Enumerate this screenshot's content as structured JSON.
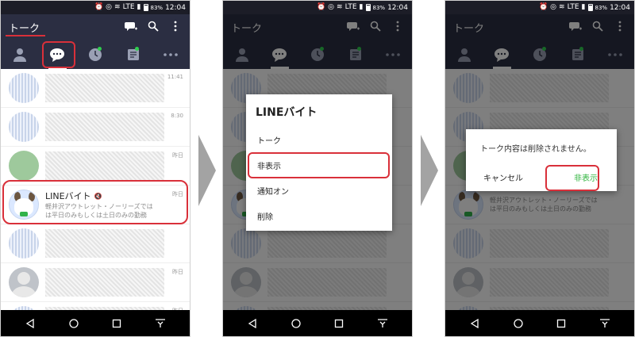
{
  "status": {
    "battery": "83%",
    "time": "12:04",
    "network": "LTE"
  },
  "header": {
    "title": "トーク",
    "icons": [
      "add-chat-icon",
      "search-icon",
      "more-vertical-icon"
    ]
  },
  "tabs": [
    {
      "name": "friends",
      "icon": "person-icon"
    },
    {
      "name": "talk",
      "icon": "chat-bubble-icon",
      "active": true
    },
    {
      "name": "timeline",
      "icon": "clock-icon",
      "badge": true
    },
    {
      "name": "news",
      "icon": "news-icon",
      "badge": true
    },
    {
      "name": "more",
      "icon": "more-horizontal-icon"
    }
  ],
  "chats": [
    {
      "avatar": "stripe",
      "time": "11:41"
    },
    {
      "avatar": "stripe",
      "time": "8:30"
    },
    {
      "avatar": "green",
      "time": "昨日"
    },
    {
      "avatar": "line",
      "time": "昨日",
      "name": "LINEバイト",
      "msg1": "軽井沢アウトレット・ノーリーズでは",
      "msg2": "は平日のみもしくは土日のみの勤務"
    },
    {
      "avatar": "stripe",
      "time": ""
    },
    {
      "avatar": "gray",
      "time": "昨日"
    },
    {
      "avatar": "stripe",
      "time": "昨日"
    }
  ],
  "context_menu": {
    "title": "LINEバイト",
    "items": [
      "トーク",
      "非表示",
      "通知オン",
      "削除"
    ]
  },
  "confirm_dialog": {
    "message": "トーク内容は削除されません。",
    "cancel_label": "キャンセル",
    "confirm_label": "非表示"
  },
  "navbar": {
    "icons": [
      "back-icon",
      "home-icon",
      "recents-icon",
      "menu-down-icon"
    ]
  },
  "colors": {
    "header_bg": "#2b2e42",
    "status_bg": "#1c1d27",
    "highlight": "#d9303a",
    "line_green": "#2fb43d"
  }
}
